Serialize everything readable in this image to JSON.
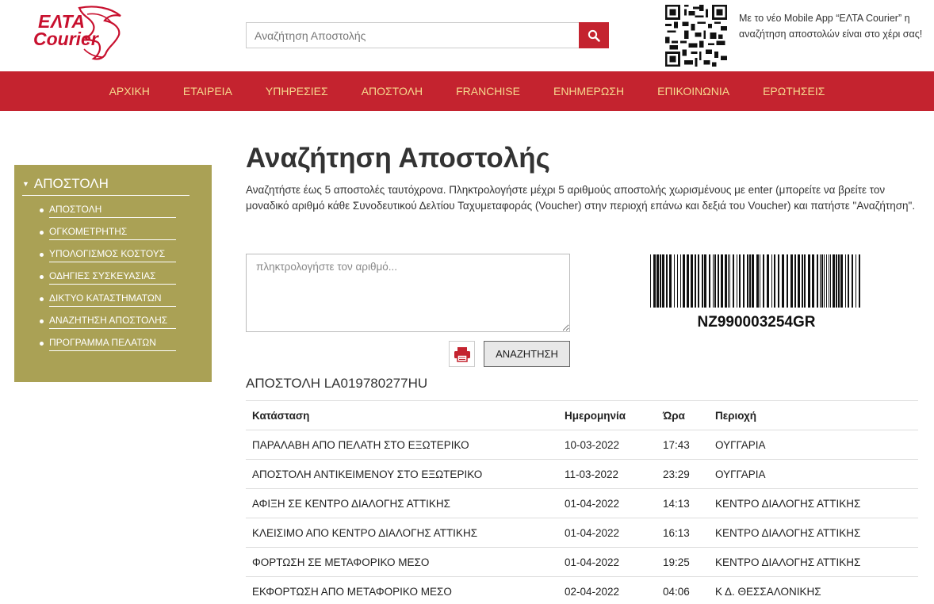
{
  "header": {
    "logo_line1": "ΕΛΤΑ",
    "logo_line2": "Courier",
    "search_placeholder": "Αναζήτηση Αποστολής",
    "app_text": "Με το νέο Mobile App “ΕΛΤΑ Courier” η αναζήτηση αποστολών είναι στο χέρι σας!",
    "icons": {
      "search": "search-icon",
      "qr": "qr-code"
    }
  },
  "nav": {
    "items": [
      "ΑΡΧΙΚΗ",
      "ΕΤΑΙΡΕΙΑ",
      "ΥΠΗΡΕΣΙΕΣ",
      "ΑΠΟΣΤΟΛΗ",
      "FRANCHISE",
      "ΕΝΗΜΕΡΩΣΗ",
      "ΕΠΙΚΟΙΝΩΝΙΑ",
      "ΕΡΩΤΗΣΕΙΣ"
    ]
  },
  "sidebar": {
    "title": "ΑΠΟΣΤΟΛΗ",
    "items": [
      "ΑΠΟΣΤΟΛΗ",
      "ΟΓΚΟΜΕΤΡΗΤΗΣ",
      "ΥΠΟΛΟΓΙΣΜΟΣ ΚΟΣΤΟΥΣ",
      "ΟΔΗΓΙΕΣ ΣΥΣΚΕΥΑΣΙΑΣ",
      "ΔΙΚΤΥΟ ΚΑΤΑΣΤΗΜΑΤΩΝ",
      "ΑΝΑΖΗΤΗΣΗ ΑΠΟΣΤΟΛΗΣ",
      "ΠΡΟΓΡΑΜΜΑ ΠΕΛΑΤΩΝ"
    ]
  },
  "main": {
    "title": "Αναζήτηση Αποστολής",
    "intro": "Αναζητήστε έως 5 αποστολές ταυτόχρονα. Πληκτρολογήστε μέχρι 5 αριθμούς αποστολής χωρισμένους με enter (μπορείτε να βρείτε τον μοναδικό αριθμό κάθε Συνοδευτικού Δελτίου Ταχυμεταφοράς (Voucher) στην περιοχή επάνω και δεξιά του Voucher) και πατήστε \"Αναζήτηση\".",
    "input_placeholder": "πληκτρολογήστε τον αριθμό...",
    "input_value": "",
    "search_button": "ΑΝΑΖΗΤΗΣΗ",
    "barcode_number": "NZ990003254GR",
    "shipment_title": "ΑΠΟΣΤΟΛΗ LA019780277HU"
  },
  "table": {
    "headers": [
      "Κατάσταση",
      "Ημερομηνία",
      "Ώρα",
      "Περιοχή"
    ],
    "rows": [
      [
        "ΠΑΡΑΛΑΒΗ ΑΠΟ ΠΕΛΑΤΗ ΣΤΟ ΕΞΩΤΕΡΙΚΟ",
        "10-03-2022",
        "17:43",
        "ΟΥΓΓΑΡΙΑ"
      ],
      [
        "ΑΠΟΣΤΟΛΗ ΑΝΤΙΚΕΙΜΕΝΟΥ ΣΤΟ ΕΞΩΤΕΡΙΚΟ",
        "11-03-2022",
        "23:29",
        "ΟΥΓΓΑΡΙΑ"
      ],
      [
        "ΑΦΙΞΗ ΣΕ ΚΕΝΤΡΟ ΔΙΑΛΟΓΗΣ ΑΤΤΙΚΗΣ",
        "01-04-2022",
        "14:13",
        "ΚΕΝΤΡΟ ΔΙΑΛΟΓΗΣ ΑΤΤΙΚΗΣ"
      ],
      [
        "ΚΛΕΙΣΙΜΟ ΑΠΟ ΚΕΝΤΡΟ ΔΙΑΛΟΓΗΣ ΑΤΤΙΚΗΣ",
        "01-04-2022",
        "16:13",
        "ΚΕΝΤΡΟ ΔΙΑΛΟΓΗΣ ΑΤΤΙΚΗΣ"
      ],
      [
        "ΦΟΡΤΩΣΗ ΣΕ ΜΕΤΑΦΟΡΙΚΟ ΜΕΣΟ",
        "01-04-2022",
        "19:25",
        "ΚΕΝΤΡΟ ΔΙΑΛΟΓΗΣ ΑΤΤΙΚΗΣ"
      ],
      [
        "ΕΚΦΟΡΤΩΣΗ ΑΠΟ ΜΕΤΑΦΟΡΙΚΟ ΜΕΣΟ",
        "02-04-2022",
        "04:06",
        "Κ Δ. ΘΕΣΣΑΛΟΝΙΚΗΣ"
      ]
    ]
  },
  "colors": {
    "brand_red": "#c4232f",
    "nav_text": "#f6d98d",
    "sidebar_bg": "#aaa155"
  }
}
